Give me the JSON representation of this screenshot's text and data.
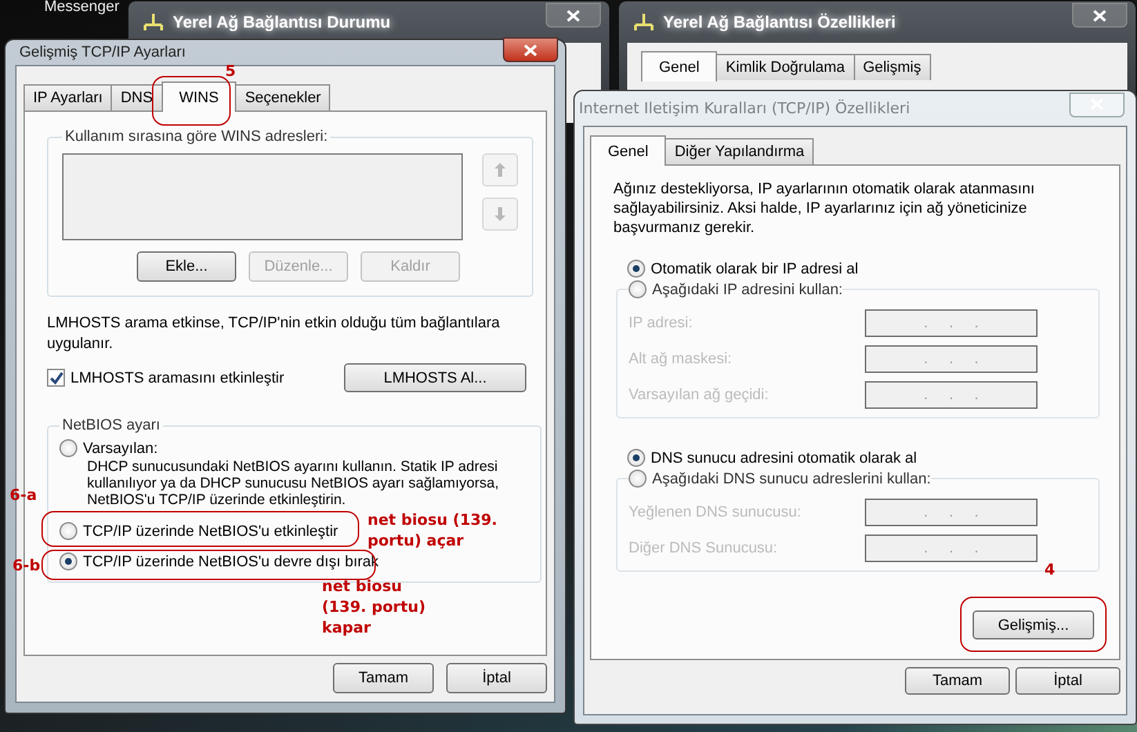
{
  "desktop": {
    "label": "Messenger"
  },
  "background_windows": [
    {
      "title": "Yerel Ağ Bağlantısı Durumu"
    },
    {
      "title": "Yerel Ağ Bağlantısı Özellikleri",
      "tabs": [
        {
          "label": "Genel",
          "selected": true
        },
        {
          "label": "Kimlik Doğrulama",
          "selected": false
        },
        {
          "label": "Gelişmiş",
          "selected": false
        }
      ]
    }
  ],
  "advanced_dialog": {
    "title": "Gelişmiş TCP/IP Ayarları",
    "tabs": [
      {
        "label": "IP Ayarları",
        "selected": false
      },
      {
        "label": "DNS",
        "selected": false
      },
      {
        "label": "WINS",
        "selected": true
      },
      {
        "label": "Seçenekler",
        "selected": false
      }
    ],
    "wins_group": {
      "label": "Kullanım sırasına göre WINS adresleri:",
      "buttons": [
        {
          "label": "Ekle...",
          "disabled": false
        },
        {
          "label": "Düzenle...",
          "disabled": true
        },
        {
          "label": "Kaldır",
          "disabled": true
        }
      ]
    },
    "lmhosts_note": "LMHOSTS arama etkinse, TCP/IP'nin etkin olduğu tüm bağlantılara uygulanır.",
    "lmhosts_checkbox": {
      "label": "LMHOSTS aramasını etkinleştir",
      "checked": true
    },
    "lmhosts_button": "LMHOSTS Al...",
    "netbios_group": {
      "label": "NetBIOS ayarı",
      "options": [
        {
          "label": "Varsayılan:",
          "selected": false,
          "description": "DHCP sunucusundaki NetBIOS ayarını kullanın. Statik IP adresi kullanılıyor ya da DHCP sunucusu NetBIOS ayarı sağlamıyorsa, NetBIOS'u TCP/IP üzerinde etkinleştirin."
        },
        {
          "label": "TCP/IP üzerinde NetBIOS'u etkinleştir",
          "selected": false
        },
        {
          "label": "TCP/IP üzerinde NetBIOS'u devre dışı bırak",
          "selected": true
        }
      ]
    },
    "buttons": [
      "Tamam",
      "İptal"
    ]
  },
  "tcpip_dialog": {
    "title": "Internet Iletişim Kuralları (TCP/IP) Özellikleri",
    "tabs": [
      {
        "label": "Genel",
        "selected": true
      },
      {
        "label": "Diğer Yapılandırma",
        "selected": false
      }
    ],
    "intro": "Ağınız destekliyorsa, IP ayarlarının otomatik olarak atanmasını sağlayabilirsiniz. Aksi halde, IP ayarlarınız için ağ yöneticinize başvurmanız gerekir.",
    "ip_options": [
      {
        "label": "Otomatik olarak bir IP adresi al",
        "selected": true
      },
      {
        "label": "Aşağıdaki IP adresini kullan:",
        "selected": false
      }
    ],
    "ip_fields": [
      {
        "label": "IP adresi:",
        "value": ".     .     .",
        "disabled": true
      },
      {
        "label": "Alt ağ maskesi:",
        "value": ".     .     .",
        "disabled": true
      },
      {
        "label": "Varsayılan ağ geçidi:",
        "value": ".     .     .",
        "disabled": true
      }
    ],
    "dns_options": [
      {
        "label": "DNS sunucu adresini otomatik olarak al",
        "selected": true
      },
      {
        "label": "Aşağıdaki DNS sunucu adreslerini kullan:",
        "selected": false
      }
    ],
    "dns_fields": [
      {
        "label": "Yeğlenen DNS sunucusu:",
        "value": ".     .     .",
        "disabled": true
      },
      {
        "label": "Diğer DNS Sunucusu:",
        "value": ".     .     .",
        "disabled": true
      }
    ],
    "advanced_button": "Gelişmiş...",
    "buttons": [
      "Tamam",
      "İptal"
    ]
  },
  "annotations": [
    {
      "text": "5"
    },
    {
      "text": "6-a"
    },
    {
      "text": "6-b"
    },
    {
      "text": "net biosu (139. portu) açar"
    },
    {
      "text": "net biosu (139. portu) kapar"
    },
    {
      "text": "4"
    }
  ]
}
